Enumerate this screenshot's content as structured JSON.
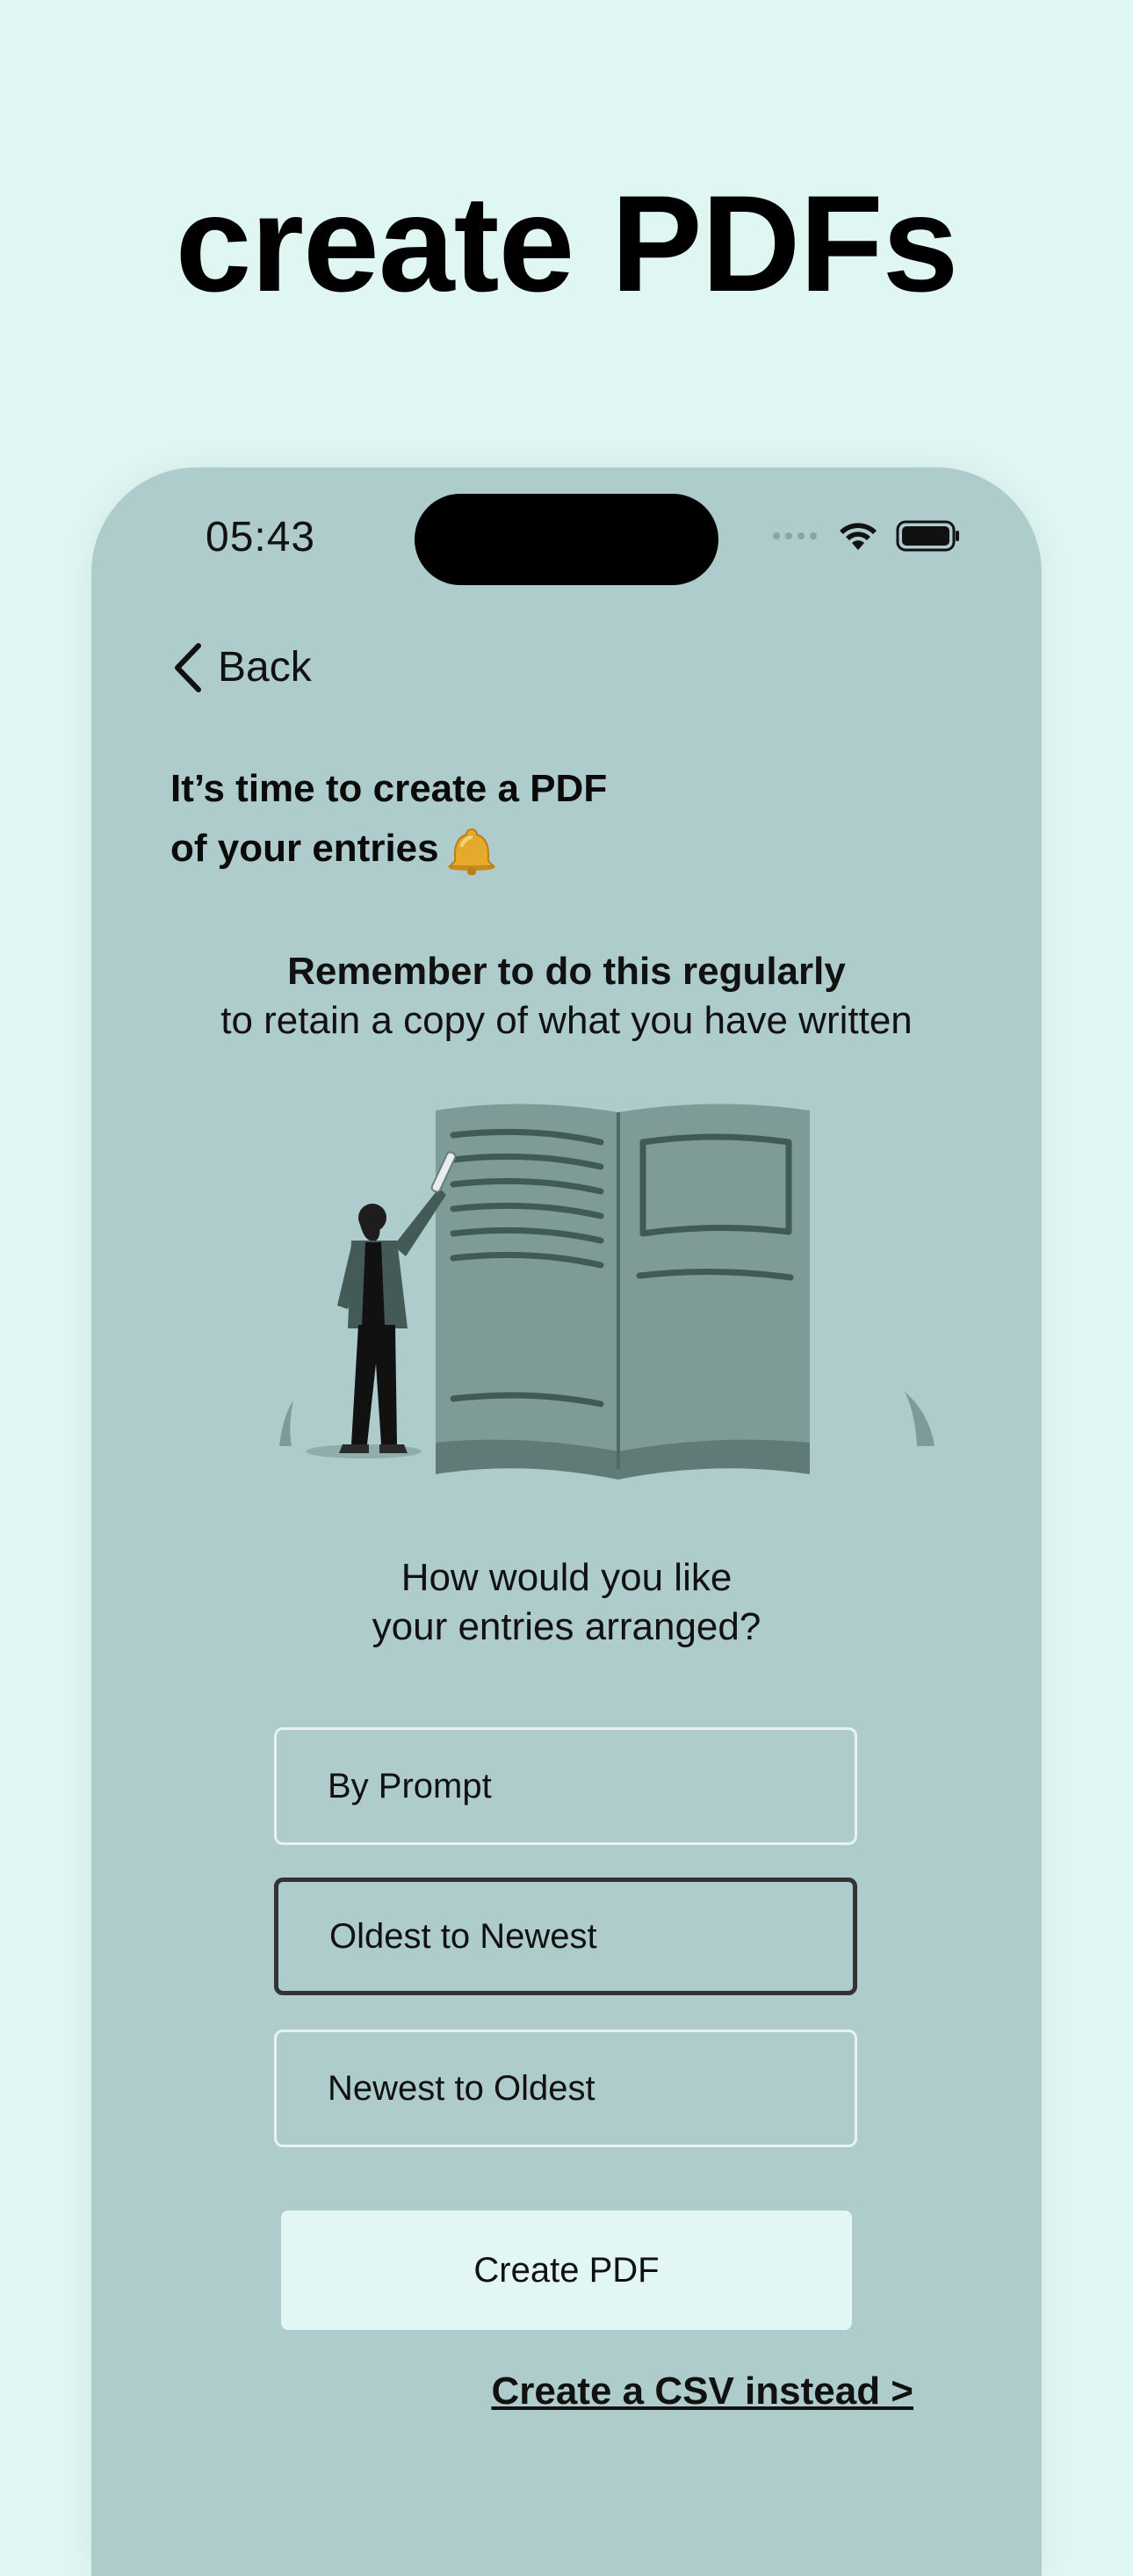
{
  "marketing": {
    "headline": "create PDFs"
  },
  "status_bar": {
    "time": "05:43"
  },
  "nav": {
    "back_label": "Back"
  },
  "intro": {
    "title_line1": "It’s time to create a PDF",
    "title_line2": "of your entries"
  },
  "reminder": {
    "bold": "Remember to do this regularly",
    "sub": "to retain a copy of what you have written"
  },
  "arrangement": {
    "question_line1": "How would you like",
    "question_line2": "your entries arranged?",
    "options": [
      {
        "label": "By Prompt",
        "selected": false
      },
      {
        "label": "Oldest to Newest",
        "selected": true
      },
      {
        "label": "Newest to Oldest",
        "selected": false
      }
    ]
  },
  "actions": {
    "create_pdf_label": "Create PDF",
    "csv_link_label": "Create a CSV instead >"
  },
  "colors": {
    "page_background": "#dff6f3",
    "phone_background": "#afcccc",
    "button_background": "#e2f7f4",
    "selected_border": "#333333",
    "illustration_book": "#7e9b98"
  },
  "icons": [
    "chevron-left-icon",
    "wifi-icon",
    "battery-icon",
    "signal-icon",
    "bell-icon"
  ]
}
